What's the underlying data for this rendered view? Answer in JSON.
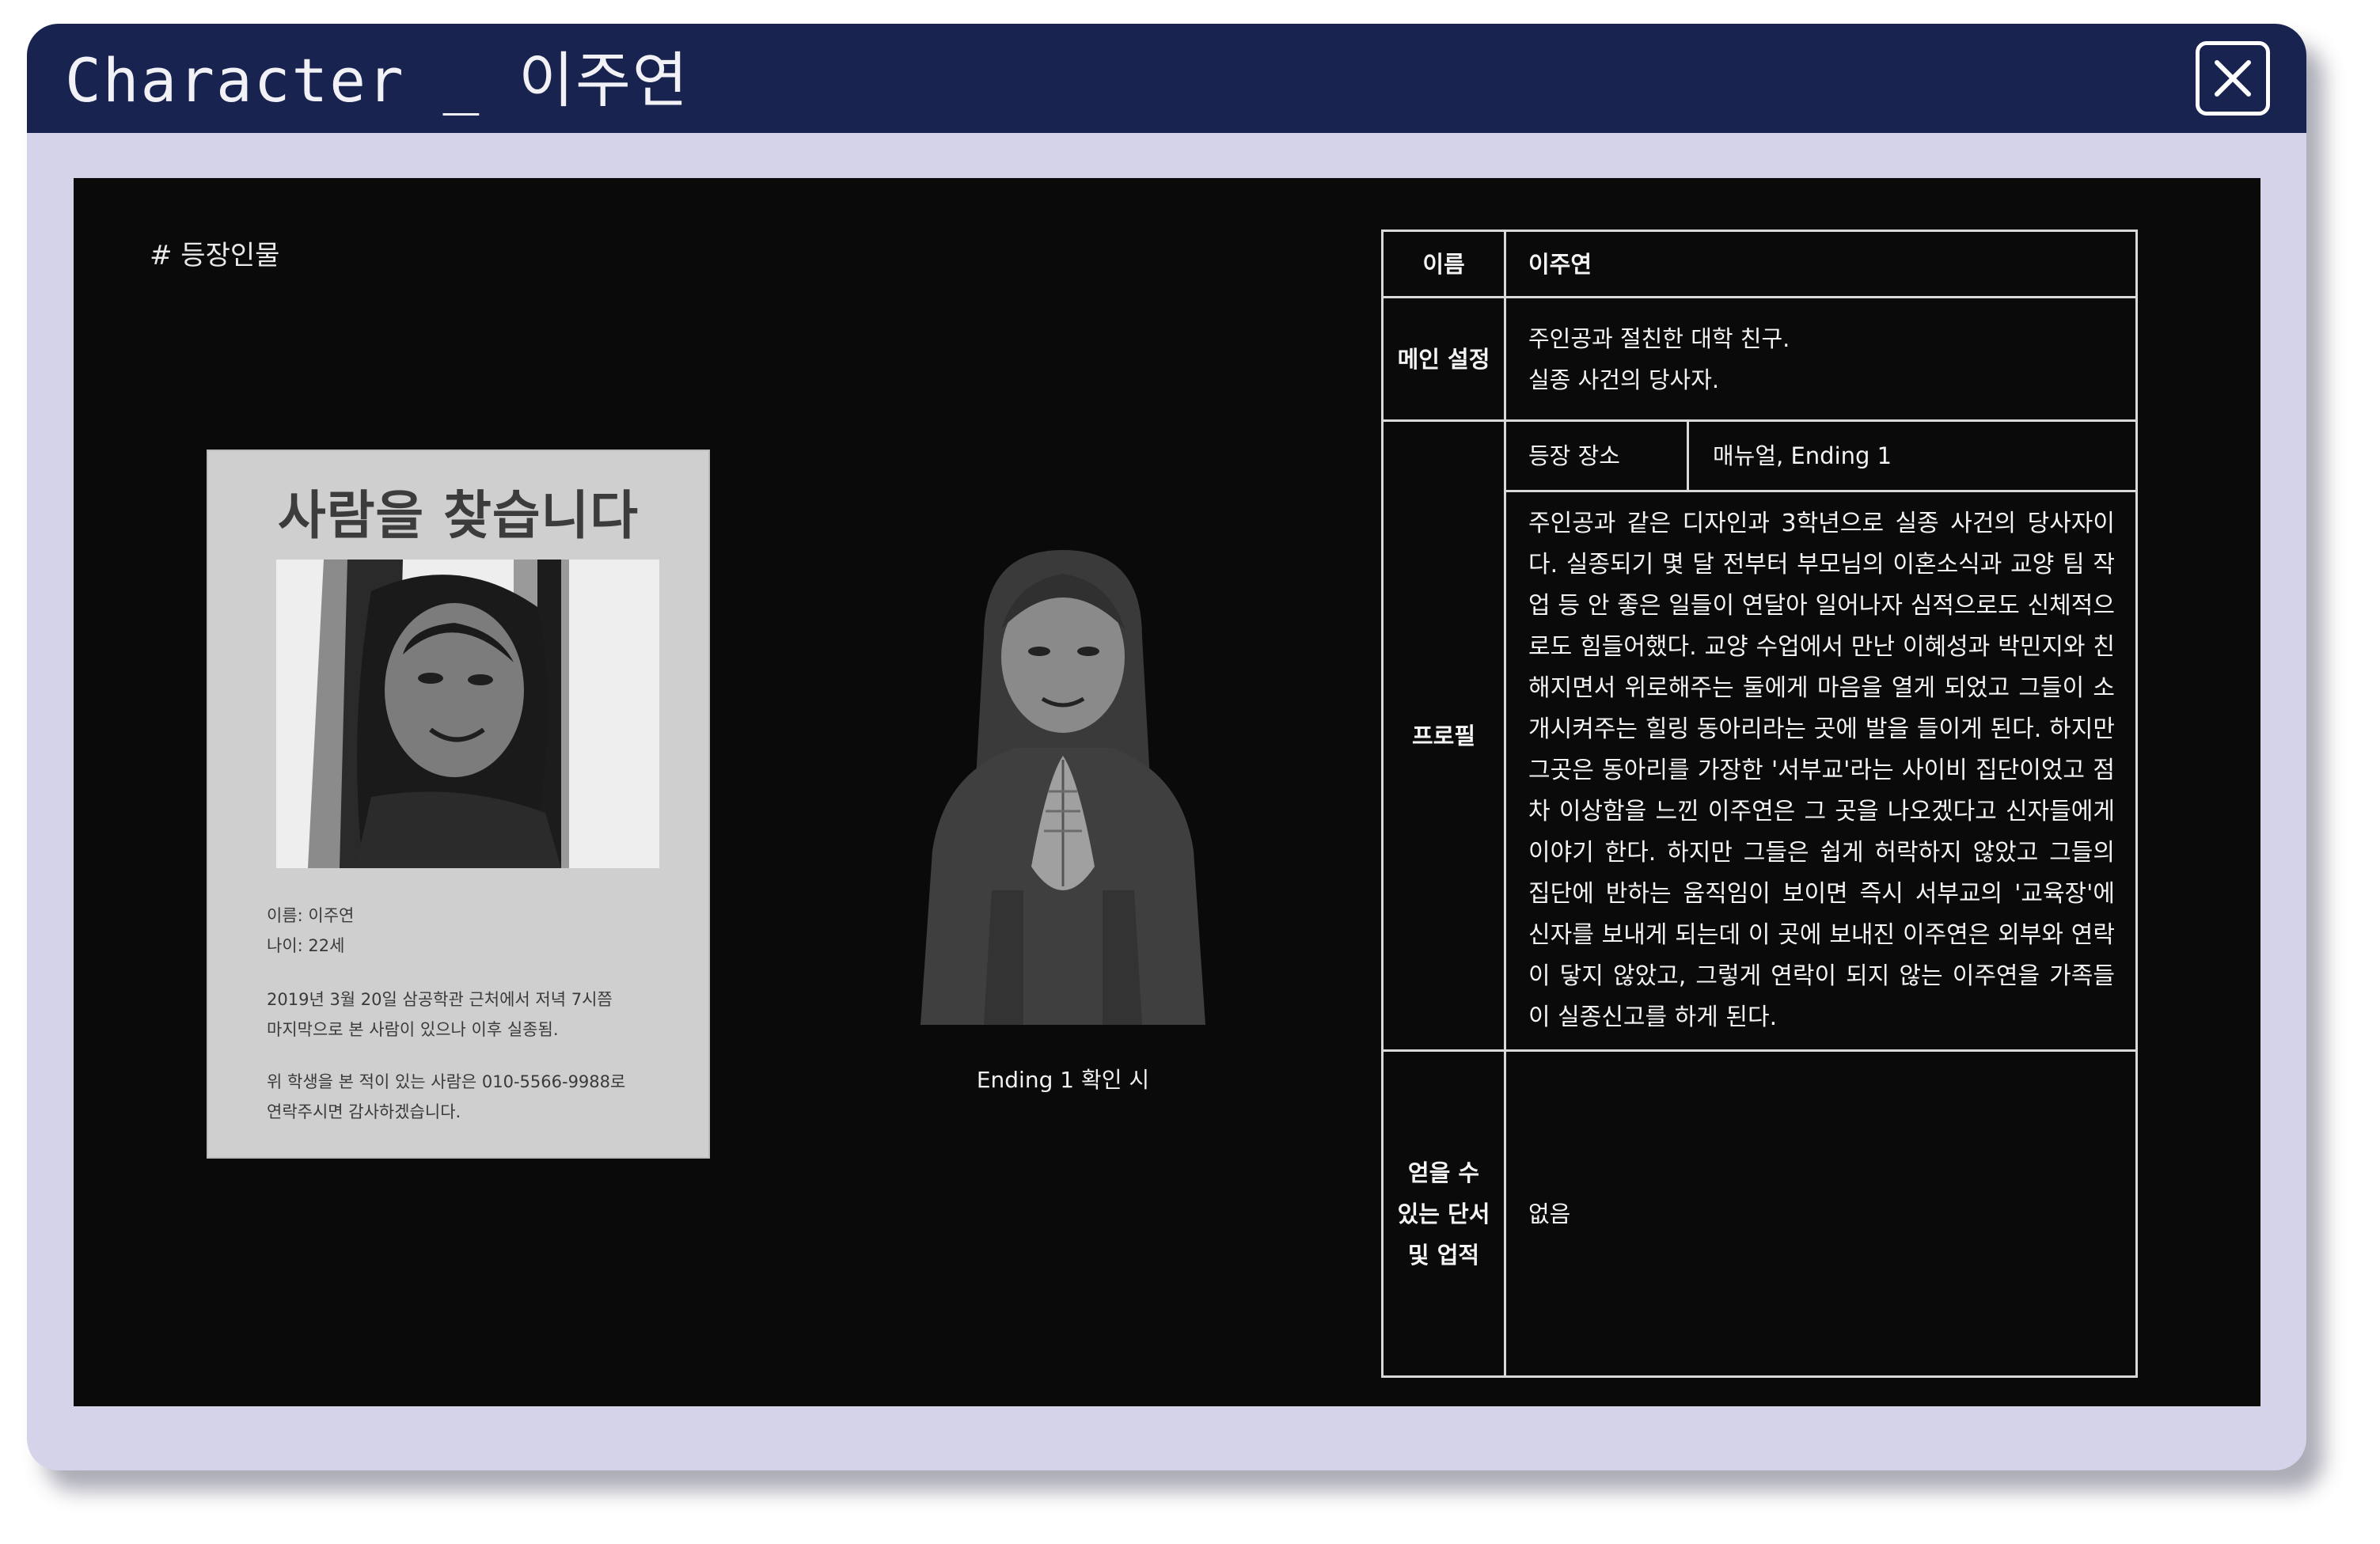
{
  "window": {
    "title": "Character _ 이주연",
    "close_icon": "close-icon"
  },
  "section_label": "# 등장인물",
  "poster": {
    "title": "사람을 찾습니다",
    "name_line": "이름: 이주연",
    "age_line": "나이: 22세",
    "desc_line1": "2019년 3월 20일 삼공학관 근처에서 저녁 7시쯤",
    "desc_line2": "마지막으로 본 사람이 있으나 이후 실종됨.",
    "contact_line1": "위 학생을 본 적이 있는 사람은 010-5566-9988로",
    "contact_line2": "연락주시면 감사하겠습니다."
  },
  "figure": {
    "caption": "Ending 1 확인 시"
  },
  "table": {
    "name_label": "이름",
    "name_value": "이주연",
    "main_label": "메인 설정",
    "main_line1": "주인공과 절친한 대학 친구.",
    "main_line2": "실종 사건의 당사자.",
    "profile_label": "프로필",
    "location_label": "등장 장소",
    "location_value": "매뉴얼, Ending 1",
    "profile_text": "주인공과 같은 디자인과 3학년으로 실종 사건의 당사자이다. 실종되기 몇 달 전부터 부모님의 이혼소식과 교양 팀 작업 등 안 좋은 일들이 연달아 일어나자 심적으로도 신체적으로도 힘들어했다. 교양 수업에서 만난 이혜성과 박민지와 친해지면서 위로해주는 둘에게 마음을 열게 되었고 그들이 소개시켜주는 힐링 동아리라는 곳에 발을 들이게 된다. 하지만 그곳은 동아리를 가장한 '서부교'라는 사이비 집단이었고 점차 이상함을 느낀 이주연은 그 곳을 나오겠다고 신자들에게 이야기 한다. 하지만 그들은 쉽게 허락하지 않았고 그들의 집단에 반하는 움직임이 보이면 즉시 서부교의 '교육장'에 신자를 보내게 되는데 이 곳에 보내진 이주연은 외부와 연락이 닿지 않았고, 그렇게 연락이 되지 않는 이주연을 가족들이 실종신고를 하게 된다.",
    "clues_label_1": "얻을 수",
    "clues_label_2": "있는 단서",
    "clues_label_3": "및 업적",
    "clues_value": "없음"
  }
}
